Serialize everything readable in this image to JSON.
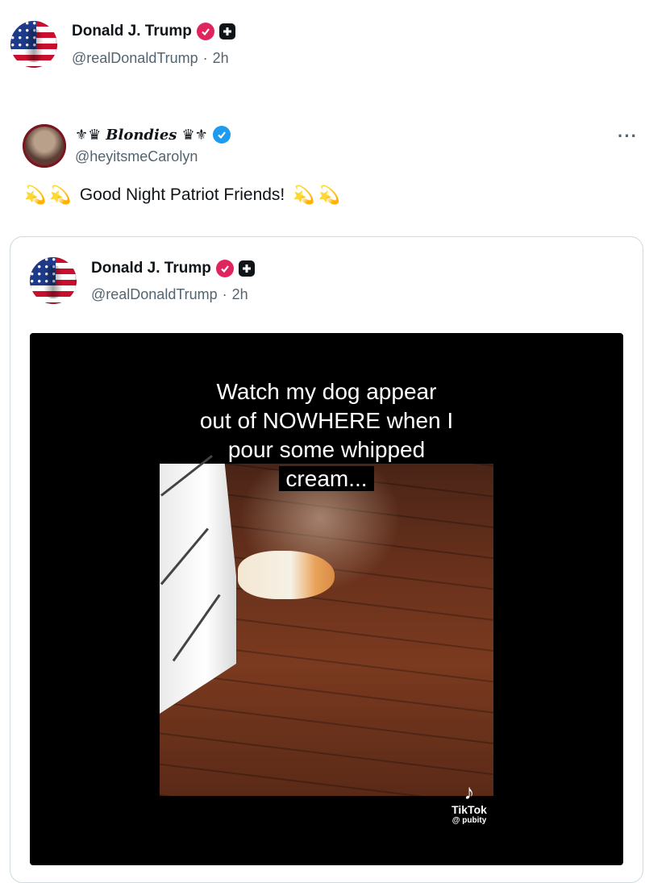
{
  "header": {
    "name": "Donald J. Trump",
    "handle": "@realDonaldTrump",
    "separator": "·",
    "time": "2h"
  },
  "tweet": {
    "name": "Blondies",
    "name_decor_left": "⚜♛",
    "name_decor_right": "♛⚜",
    "handle": "@heyitsmeCarolyn",
    "more_label": "···",
    "text": "Good Night Patriot Friends!",
    "emoji": "💫"
  },
  "quote": {
    "name": "Donald J. Trump",
    "handle": "@realDonaldTrump",
    "separator": "·",
    "time": "2h"
  },
  "video": {
    "caption_lines": [
      "Watch my dog appear",
      "out of NOWHERE when I",
      "pour some whipped",
      "cream..."
    ],
    "watermark_brand": "TikTok",
    "watermark_user": "@ pubity"
  },
  "colors": {
    "verified_pink": "#e0245e",
    "verified_blue": "#1d9bf0",
    "handle_gray": "#536471"
  }
}
